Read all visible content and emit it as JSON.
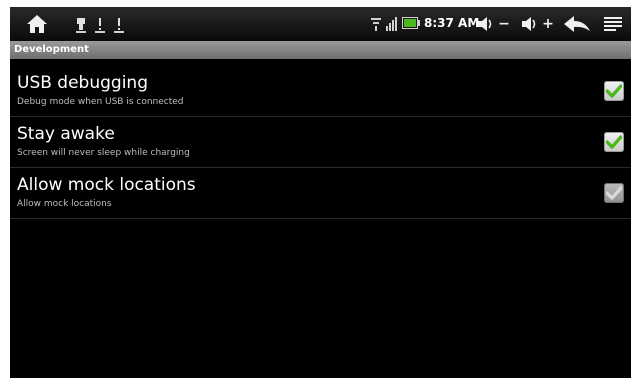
{
  "status_bar": {
    "time": "8:37 AM",
    "icons": {
      "home": "home-icon",
      "notifications": [
        "usb-notification-icon",
        "warning-notification-icon",
        "warning-notification-icon"
      ],
      "wifi": "wifi-icon",
      "signal": "signal-icon",
      "battery": "battery-icon",
      "volume_down": "volume-down-icon",
      "volume_up": "volume-up-icon",
      "back": "back-icon",
      "menu": "menu-icon"
    },
    "labels": {
      "vol_down_sign": "−",
      "vol_up_sign": "+"
    }
  },
  "category": {
    "title": "Development"
  },
  "preferences": [
    {
      "title": "USB debugging",
      "summary": "Debug mode when USB is connected",
      "checked": true,
      "enabled": true
    },
    {
      "title": "Stay awake",
      "summary": "Screen will never sleep while charging",
      "checked": true,
      "enabled": true
    },
    {
      "title": "Allow mock locations",
      "summary": "Allow mock locations",
      "checked": true,
      "enabled": false
    }
  ],
  "colors": {
    "background": "#000000",
    "check_green": "#4cb81e",
    "check_disabled": "#d8d8d8",
    "category_bg": "#7f7f7f"
  }
}
